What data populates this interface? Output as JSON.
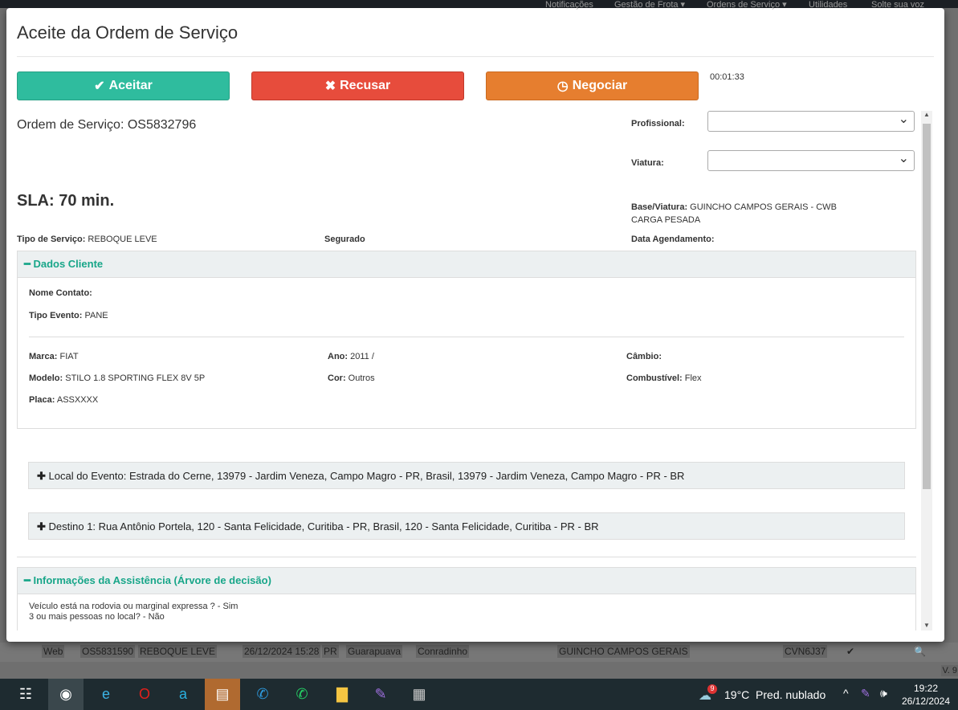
{
  "background": {
    "nav": [
      "Notificações",
      "Gestão de Frota ▾",
      "Ordens de Serviço ▾",
      "Utilidades",
      "Solte sua voz"
    ],
    "row": [
      "Web",
      "OS5831590",
      "REBOQUE LEVE",
      "26/12/2024 15:28",
      "PR",
      "Guarapuava",
      "Conradinho",
      "GUINCHO CAMPOS GERAIS",
      "CVN6J37"
    ],
    "version": "V. 9"
  },
  "modal": {
    "title": "Aceite da Ordem de Serviço",
    "buttons": {
      "accept": "Aceitar",
      "refuse": "Recusar",
      "negotiate": "Negociar"
    },
    "colors": {
      "accept": "#2fbc9e",
      "refuse": "#e74c3c",
      "negotiate": "#e67e2f"
    },
    "timer": "00:01:33",
    "os_label": "Ordem de Serviço: OS5832796",
    "sla": "SLA: 70 min.",
    "profissional_label": "Profissional:",
    "profissional_value": "",
    "viatura_label": "Viatura:",
    "viatura_value": "",
    "base_label": "Base/Viatura:",
    "base_value": " GUINCHO CAMPOS GERAIS - CWB",
    "base_value2": "CARGA PESADA",
    "tipo_servico_label": "Tipo de Serviço:",
    "tipo_servico_value": " REBOQUE LEVE",
    "segurado_label": "Segurado",
    "agendamento_label": "Data Agendamento:",
    "cliente": {
      "title": "Dados Cliente",
      "nome_label": "Nome Contato:",
      "evento_label": "Tipo Evento:",
      "evento_value": " PANE",
      "marca_label": "Marca:",
      "marca_value": " FIAT",
      "ano_label": "Ano:",
      "ano_value": " 2011 /",
      "cambio_label": "Câmbio:",
      "modelo_label": "Modelo:",
      "modelo_value": " STILO 1.8 SPORTING FLEX 8V 5P",
      "cor_label": "Cor:",
      "cor_value": " Outros",
      "combustivel_label": "Combustível:",
      "combustivel_value": " Flex",
      "placa_label": "Placa:",
      "placa_value": " ASSXXXX"
    },
    "local": "Local do Evento: Estrada do Cerne, 13979 - Jardim Veneza, Campo Magro - PR, Brasil, 13979 - Jardim Veneza, Campo Magro - PR - BR",
    "destino": "Destino 1: Rua Antônio Portela, 120 - Santa Felicidade, Curitiba - PR, Brasil, 120 - Santa Felicidade, Curitiba - PR - BR",
    "assistencia": {
      "title": "Informações da Assistência (Árvore de decisão)",
      "lines": [
        "Veículo está na rodovia ou marginal expressa ? - Sim",
        "3 ou mais pessoas no local? - Não"
      ]
    }
  },
  "taskbar": {
    "weather": "19°C  Pred. nublado",
    "weather_badge": "9",
    "time": "19:22",
    "date": "26/12/2024"
  }
}
